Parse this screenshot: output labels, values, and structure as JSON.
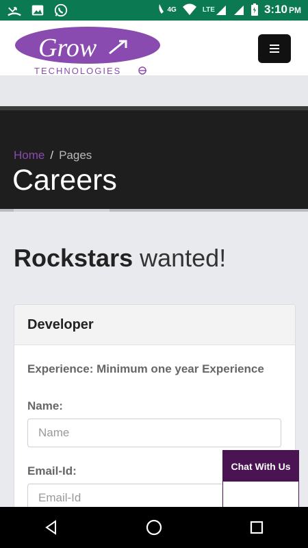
{
  "status_bar": {
    "time": "3:10",
    "ampm": "PM",
    "network_4g": "4G",
    "network_lte": "LTE",
    "icons": [
      "missed-call-icon",
      "image-icon",
      "whatsapp-icon",
      "phone-signal-icon",
      "wifi-icon",
      "signal-icon",
      "battery-icon"
    ]
  },
  "header": {
    "logo_text": "Grow",
    "logo_subtext": "TECHNOLOGIES",
    "brand_color": "#8a4bb0"
  },
  "hero": {
    "breadcrumb_home": "Home",
    "breadcrumb_sep": "/",
    "breadcrumb_current": "Pages",
    "title": "Careers"
  },
  "section": {
    "title_bold": "Rockstars",
    "title_light": "wanted!"
  },
  "job_card": {
    "title": "Developer",
    "experience": "Experience: Minimum one year Experience",
    "name_label": "Name:",
    "name_placeholder": "Name",
    "email_label": "Email-Id:",
    "email_placeholder": "Email-Id"
  },
  "chat_widget": {
    "label": "Chat With Us",
    "color": "#4a1452"
  },
  "nav_bar": {
    "icons": [
      "back-icon",
      "home-icon",
      "recents-icon"
    ]
  }
}
